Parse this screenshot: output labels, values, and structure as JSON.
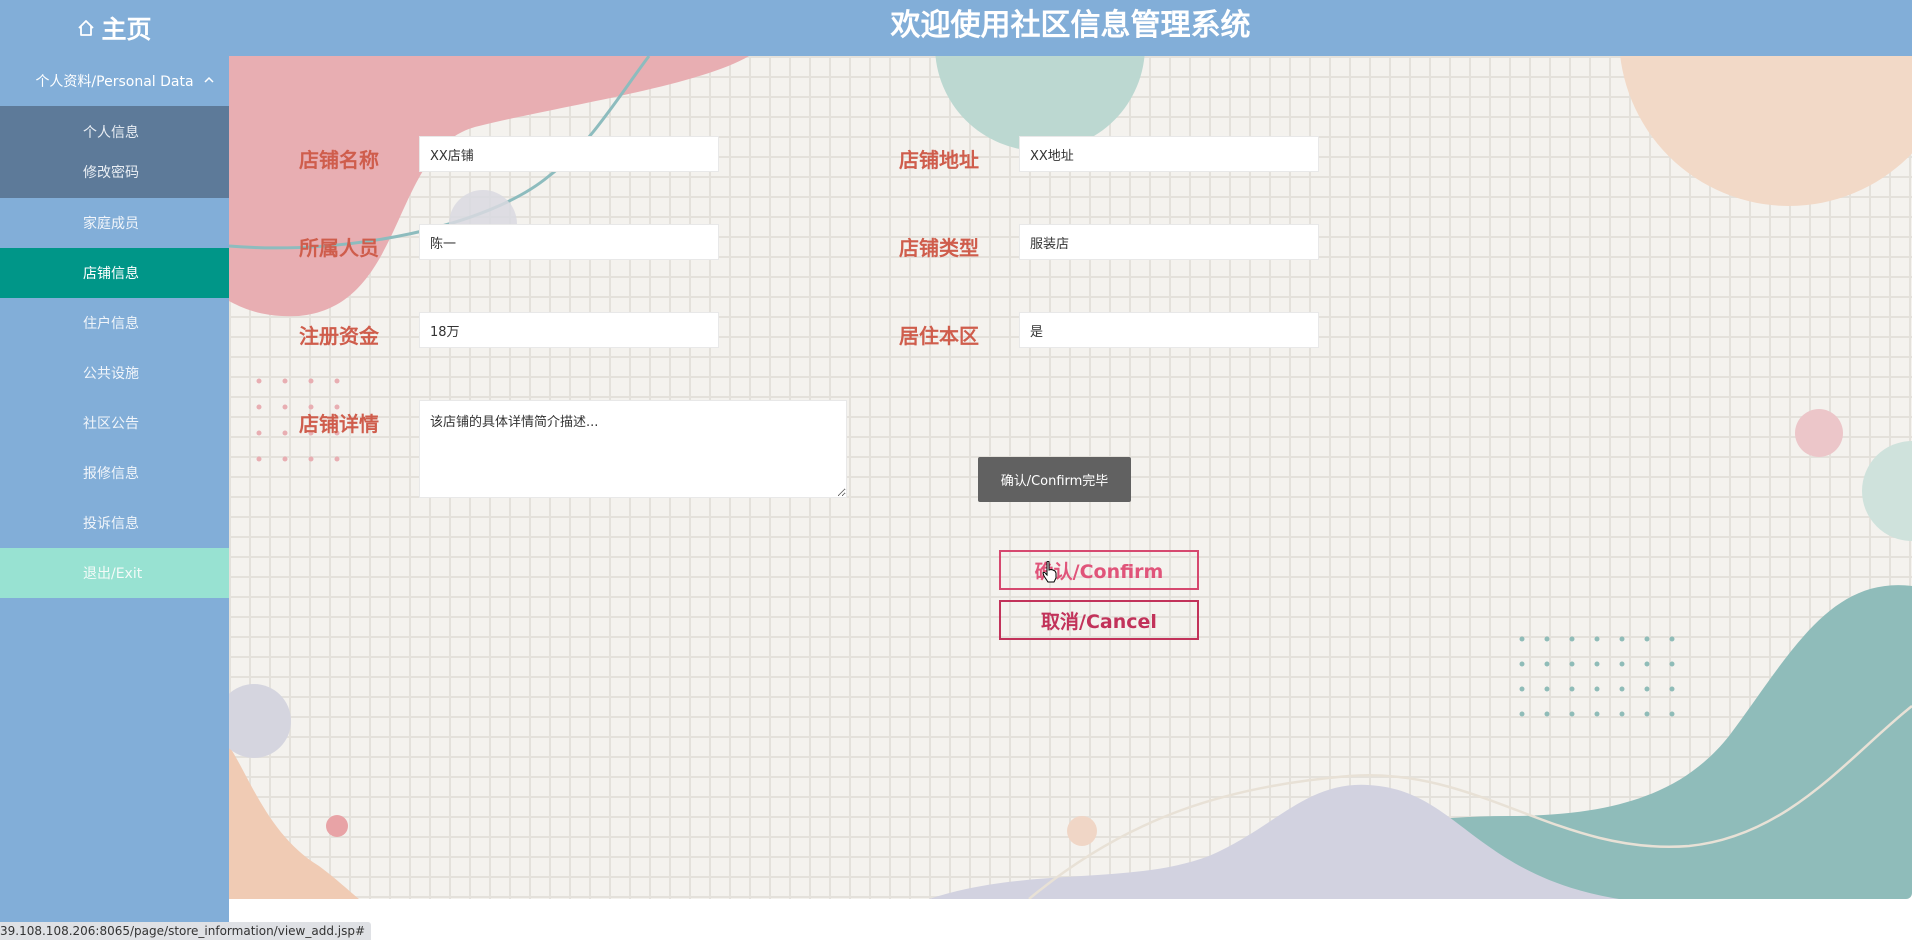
{
  "header": {
    "home_label": "主页",
    "home_icon": "home-icon",
    "title": "欢迎使用社区信息管理系统"
  },
  "sidebar": {
    "group_label": "个人资料/Personal Data",
    "group_expanded": true,
    "sub_items": [
      {
        "label": "个人信息"
      },
      {
        "label": "修改密码"
      }
    ],
    "items": [
      {
        "label": "家庭成员"
      },
      {
        "label": "店铺信息",
        "active": true
      },
      {
        "label": "住户信息"
      },
      {
        "label": "公共设施"
      },
      {
        "label": "社区公告"
      },
      {
        "label": "报修信息"
      },
      {
        "label": "投诉信息"
      }
    ],
    "exit_label": "退出/Exit"
  },
  "form": {
    "store_name": {
      "label": "店铺名称",
      "value": "XX店铺"
    },
    "store_address": {
      "label": "店铺地址",
      "value": "XX地址"
    },
    "owner": {
      "label": "所属人员",
      "value": "陈一"
    },
    "store_type": {
      "label": "店铺类型",
      "value": "服装店"
    },
    "capital": {
      "label": "注册资金",
      "value": "18万"
    },
    "resident": {
      "label": "居住本区",
      "value": "是"
    },
    "details": {
      "label": "店铺详情",
      "value": "该店铺的具体详情简介描述..."
    }
  },
  "tooltip": "确认/Confirm完毕",
  "buttons": {
    "confirm_label": "确认/Confirm",
    "cancel_label": "取消/Cancel"
  },
  "status_url": "39.108.108.206:8065/page/store_information/view_add.jsp#",
  "colors": {
    "header_bg": "#82aed8",
    "sidebar_active": "#009688",
    "sidebar_exit": "#98e2d2",
    "label_color": "#cf5d4c",
    "button_color": "#c2325a"
  }
}
